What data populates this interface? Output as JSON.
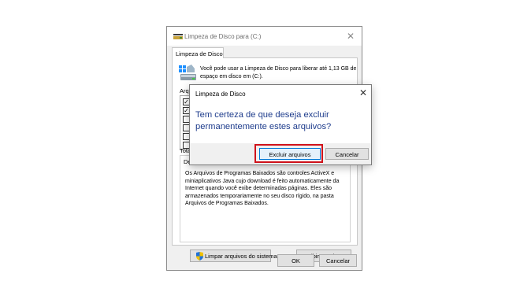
{
  "main_window": {
    "title": "Limpeza de Disco para  (C:)",
    "tab_label": "Limpeza de Disco",
    "intro_text": "Você pode usar a Limpeza de Disco para liberar até 1,13 GB de espaço em disco em  (C:).",
    "files_label": "Arqu",
    "total_label": "Tota",
    "description_label": "De",
    "description_text": "Os Arquivos de Programas Baixados são controles ActiveX e miniaplicativos Java cujo download é feito automaticamente da Internet quando você exibe determinadas páginas. Eles são armazenados temporariamente no seu disco rígido, na pasta Arquivos de Programas Baixados.",
    "clean_system_button": "Limpar arquivos do sistema",
    "view_files_button": "Exibir Arquivos",
    "ok_button": "OK",
    "cancel_button": "Cancelar",
    "close_glyph": "✕",
    "file_checkboxes": [
      {
        "checked": true,
        "mark": "✓"
      },
      {
        "checked": true,
        "mark": "✓"
      },
      {
        "checked": false,
        "mark": ""
      },
      {
        "checked": false,
        "mark": ""
      },
      {
        "checked": false,
        "mark": ""
      },
      {
        "checked": false,
        "mark": ""
      }
    ]
  },
  "confirm_dialog": {
    "title": "Limpeza de Disco",
    "message": "Tem certeza de que deseja excluir permanentemente estes arquivos?",
    "delete_button": "Excluir arquivos",
    "cancel_button": "Cancelar",
    "close_glyph": "✕"
  },
  "colors": {
    "message_text": "#1e3c8c",
    "highlight_border": "#d0121b",
    "default_button_border": "#0078d7"
  },
  "icons": [
    "disk-cleanup-icon",
    "drive-icon",
    "shield-icon",
    "close-icon",
    "checkbox-checked-icon"
  ]
}
